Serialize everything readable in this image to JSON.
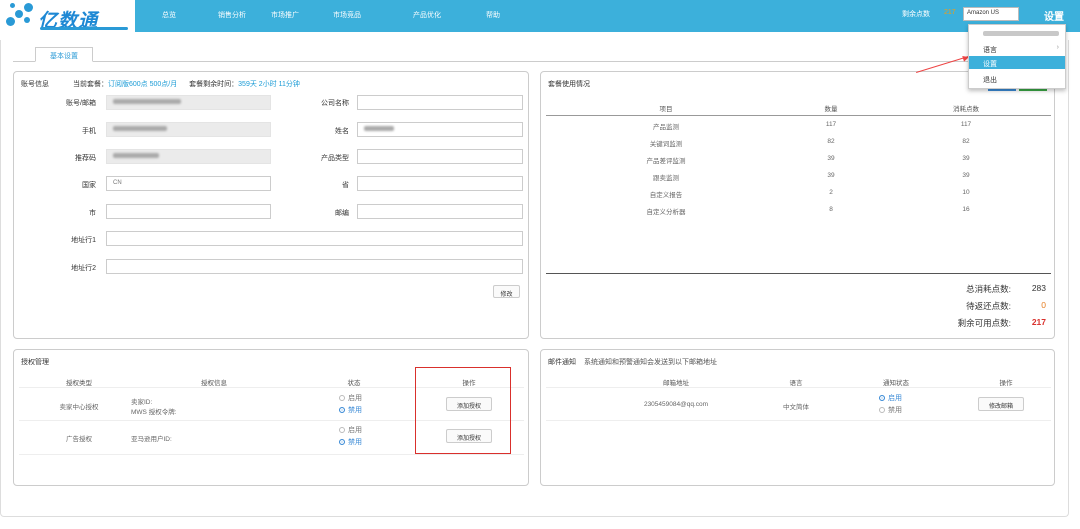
{
  "header": {
    "logo_text": "亿数通",
    "nav": [
      "总览",
      "销售分析",
      "市场推广",
      "市场竞品",
      "产品优化",
      "帮助"
    ],
    "remaining_points_label": "剩余点数",
    "remaining_points_value": "217",
    "market_select": "Amazon US",
    "settings_label": "设置"
  },
  "dropdown": {
    "items": [
      {
        "label": "语言",
        "has_submenu": true
      },
      {
        "label": "设置",
        "active": true
      },
      {
        "label": "退出"
      }
    ]
  },
  "tabs": [
    {
      "label": "基本设置",
      "active": true
    }
  ],
  "account": {
    "title": "账号信息",
    "plan_label": "当前套餐：",
    "plan_value": "订阅版600点 500点/月",
    "time_label": "套餐剩余时间：",
    "time_value": "359天 2小时 11分钟",
    "fields": {
      "email_label": "账号/邮箱",
      "company_label": "公司名称",
      "phone_label": "手机",
      "name_label": "姓名",
      "referral_label": "推荐码",
      "product_type_label": "产品类型",
      "country_label": "国家",
      "country_value": "CN",
      "state_label": "省",
      "city_label": "市",
      "zip_label": "邮编",
      "address1_label": "地址行1",
      "address2_label": "地址行2"
    },
    "save_label": "修改"
  },
  "usage": {
    "title": "套餐使用情况",
    "columns": [
      "项目",
      "数量",
      "消耗点数"
    ],
    "rows": [
      [
        "产品监测",
        "117",
        "117"
      ],
      [
        "关键词监测",
        "82",
        "82"
      ],
      [
        "产品差评监测",
        "39",
        "39"
      ],
      [
        "跟卖监测",
        "39",
        "39"
      ],
      [
        "自定义报告",
        "2",
        "10"
      ],
      [
        "自定义分析器",
        "8",
        "16"
      ]
    ],
    "total_label": "总消耗点数:",
    "total_value": "283",
    "pending_label": "待返还点数:",
    "pending_value": "0",
    "remaining_label": "剩余可用点数:",
    "remaining_value": "217",
    "colors": {
      "total": "#333333",
      "pending": "#e67e22",
      "remaining": "#d9302c"
    }
  },
  "auth": {
    "title": "授权管理",
    "columns": [
      "授权类型",
      "授权信息",
      "状态",
      "操作"
    ],
    "rows": [
      {
        "type": "卖家中心授权",
        "info_line1": "卖家ID:",
        "info_line2": "MWS 授权令牌:",
        "enable_label": "启用",
        "disable_label": "禁用",
        "action": "添加授权"
      },
      {
        "type": "广告授权",
        "info_line1": "亚马逊用户ID:",
        "info_line2": "",
        "enable_label": "启用",
        "disable_label": "禁用",
        "action": "添加授权"
      }
    ]
  },
  "mail": {
    "title": "邮件通知",
    "subtitle": "系统通知和预警通知会发送到以下邮箱地址",
    "columns": [
      "邮箱地址",
      "语言",
      "通知状态",
      "操作"
    ],
    "rows": [
      {
        "email": "2305459084@qq.com",
        "language": "中文简体",
        "enable_label": "启用",
        "disable_label": "禁用",
        "action": "修改邮箱"
      }
    ]
  }
}
